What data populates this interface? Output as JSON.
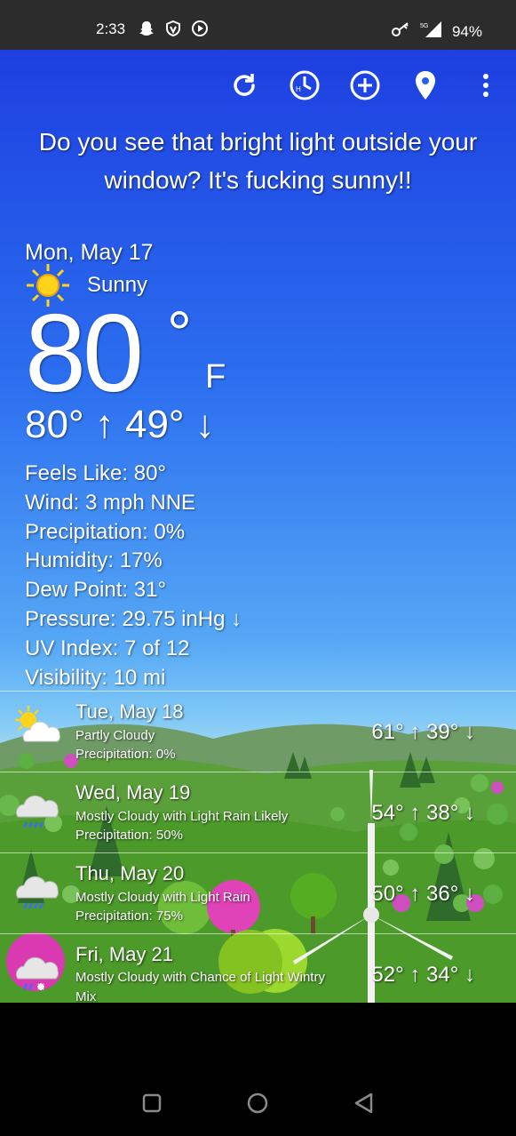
{
  "status_bar": {
    "time": "2:33",
    "left_icons": [
      "snapchat-icon",
      "vpn-shield-icon",
      "media-icon"
    ],
    "right_icons": [
      "key-icon",
      "signal-5g-icon"
    ],
    "network": "5G",
    "battery": "94%"
  },
  "toolbar": {
    "items": [
      "refresh-icon",
      "history-icon",
      "add-icon",
      "location-pin-icon",
      "more-vert-icon"
    ]
  },
  "quote": "Do you see that bright light outside your window? It's fucking sunny!!",
  "current": {
    "date": "Mon, May 17",
    "condition": "Sunny",
    "icon": "sun-icon",
    "temp": "80",
    "degree": "°",
    "unit": "F",
    "hilo": "80° ↑  49° ↓",
    "details": [
      "Feels Like: 80°",
      "Wind: 3 mph NNE",
      "Precipitation: 0%",
      "Humidity: 17%",
      "Dew Point: 31°",
      "Pressure: 29.75 inHg ↓",
      "UV Index: 7 of 12",
      "Visibility: 10 mi"
    ]
  },
  "forecast": [
    {
      "date": "Tue, May 18",
      "desc": "Partly Cloudy",
      "precip": "Precipitation: 0%",
      "hilo": "61° ↑  39° ↓",
      "icon": "partly-cloudy-icon"
    },
    {
      "date": "Wed, May 19",
      "desc": "Mostly Cloudy with Light Rain Likely",
      "precip": "Precipitation: 50%",
      "hilo": "54° ↑  38° ↓",
      "icon": "cloud-rain-icon"
    },
    {
      "date": "Thu, May 20",
      "desc": "Mostly Cloudy with Light Rain",
      "precip": "Precipitation: 75%",
      "hilo": "50° ↑  36° ↓",
      "icon": "cloud-rain-icon"
    },
    {
      "date": "Fri, May 21",
      "desc": "Mostly Cloudy with Chance of Light Wintry Mix",
      "precip": "",
      "hilo": "52° ↑  34° ↓",
      "icon": "cloud-wintry-mix-icon"
    }
  ],
  "nav": [
    "recents-button",
    "home-button",
    "back-button"
  ],
  "colors": {
    "sky_top": "#1d3fe0",
    "sky_bottom": "#a7d8f3",
    "grass": "#4c9a2a",
    "sun": "#ffd21c"
  }
}
